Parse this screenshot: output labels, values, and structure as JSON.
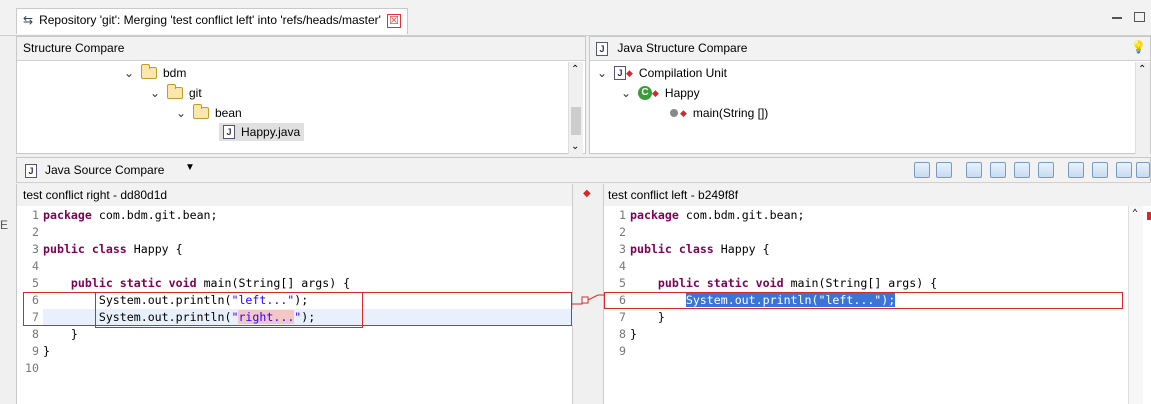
{
  "title_tab": {
    "label": "Repository 'git': Merging 'test conflict left' into 'refs/heads/master'",
    "close": "☒"
  },
  "structure_compare": {
    "header": "Structure Compare",
    "tree": [
      {
        "label": "bdm"
      },
      {
        "label": "git"
      },
      {
        "label": "bean"
      },
      {
        "label": "Happy.java"
      }
    ]
  },
  "java_structure": {
    "header": "Java Structure Compare",
    "tree": [
      {
        "label": "Compilation Unit"
      },
      {
        "label": "Happy"
      },
      {
        "label": "main(String [])"
      }
    ]
  },
  "source_compare": {
    "header": "Java Source Compare"
  },
  "left_pane": {
    "title": "test conflict right - dd80d1d",
    "line_numbers": [
      "1",
      "2",
      "3",
      "4",
      "5",
      "6",
      "7",
      "8",
      "9",
      "10"
    ],
    "lines": [
      "package com.bdm.git.bean;",
      "",
      "public class Happy {",
      "",
      "    public static void main(String[] args) {",
      "        System.out.println(\"left...\");",
      "        System.out.println(\"right...\");",
      "    }",
      "}",
      ""
    ]
  },
  "right_pane": {
    "title": "test conflict left - b249f8f",
    "line_numbers": [
      "1",
      "2",
      "3",
      "4",
      "5",
      "6",
      "7",
      "8",
      "9"
    ],
    "lines": [
      "package com.bdm.git.bean;",
      "",
      "public class Happy {",
      "",
      "    public static void main(String[] args) {",
      "        System.out.println(\"left...\");",
      "    }",
      "}",
      ""
    ]
  },
  "colors": {
    "keyword": "#7f0055",
    "string": "#2a00ff",
    "conflict": "#d9262b",
    "selection": "#3875d7"
  }
}
